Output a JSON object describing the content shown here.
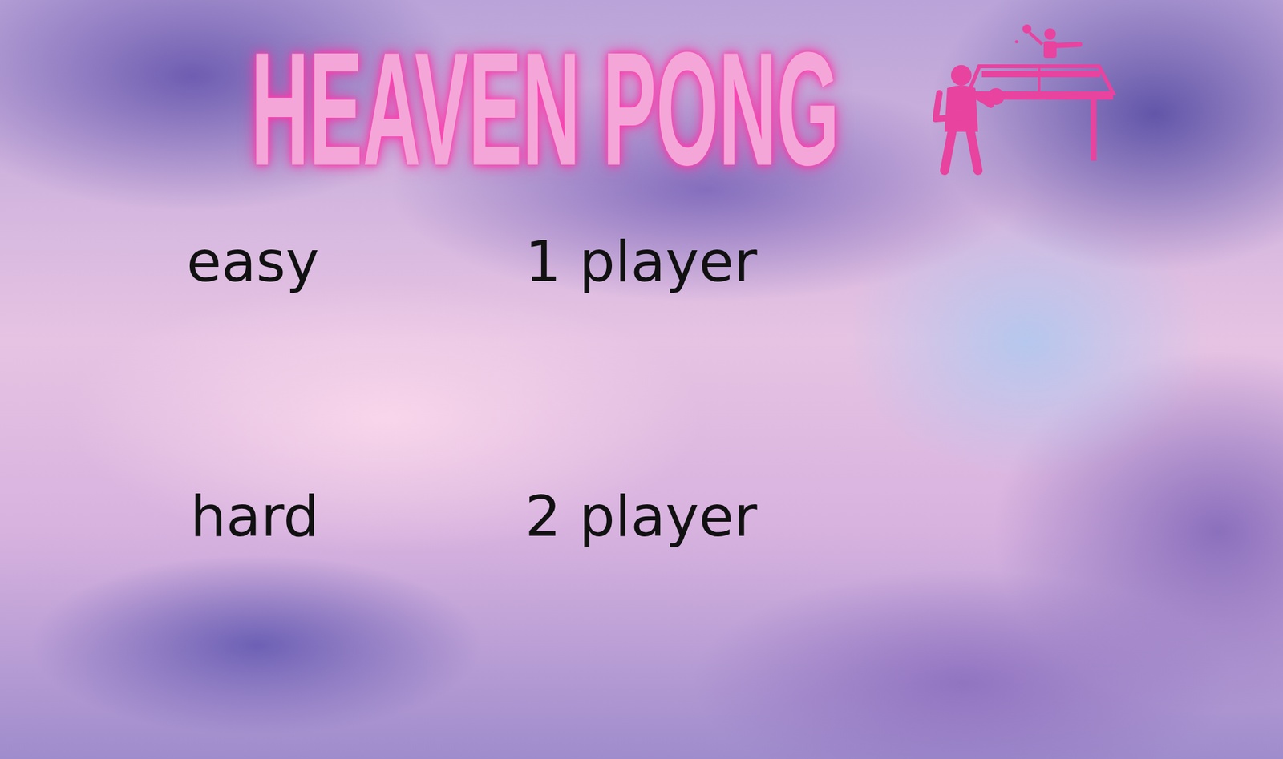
{
  "title": "HEAVEN PONG",
  "menu": [
    {
      "label": "easy"
    },
    {
      "label": "1 player"
    },
    {
      "label": "hard"
    },
    {
      "label": "2 player"
    }
  ]
}
